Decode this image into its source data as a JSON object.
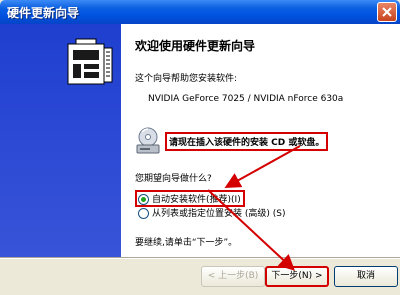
{
  "window": {
    "title": "硬件更新向导"
  },
  "wizard": {
    "heading": "欢迎使用硬件更新向导",
    "intro": "这个向导帮助您安装软件:",
    "device": "NVIDIA GeForce 7025 / NVIDIA nForce 630a",
    "cd_prompt": "请现在插入该硬件的安装 CD 或软盘。",
    "question": "您期望向导做什么?",
    "options": [
      {
        "label": "自动安装软件(推荐)(I)",
        "checked": true
      },
      {
        "label": "从列表或指定位置安装 (高级) (S)",
        "checked": false
      }
    ],
    "continue_text": "要继续,请单击“下一步”。"
  },
  "buttons": {
    "back": "< 上一步(B)",
    "next": "下一步(N) >",
    "cancel": "取消"
  },
  "colors": {
    "titlebar": "#0054e3",
    "left_panel": "#2b4acf",
    "highlight": "#d40000"
  }
}
